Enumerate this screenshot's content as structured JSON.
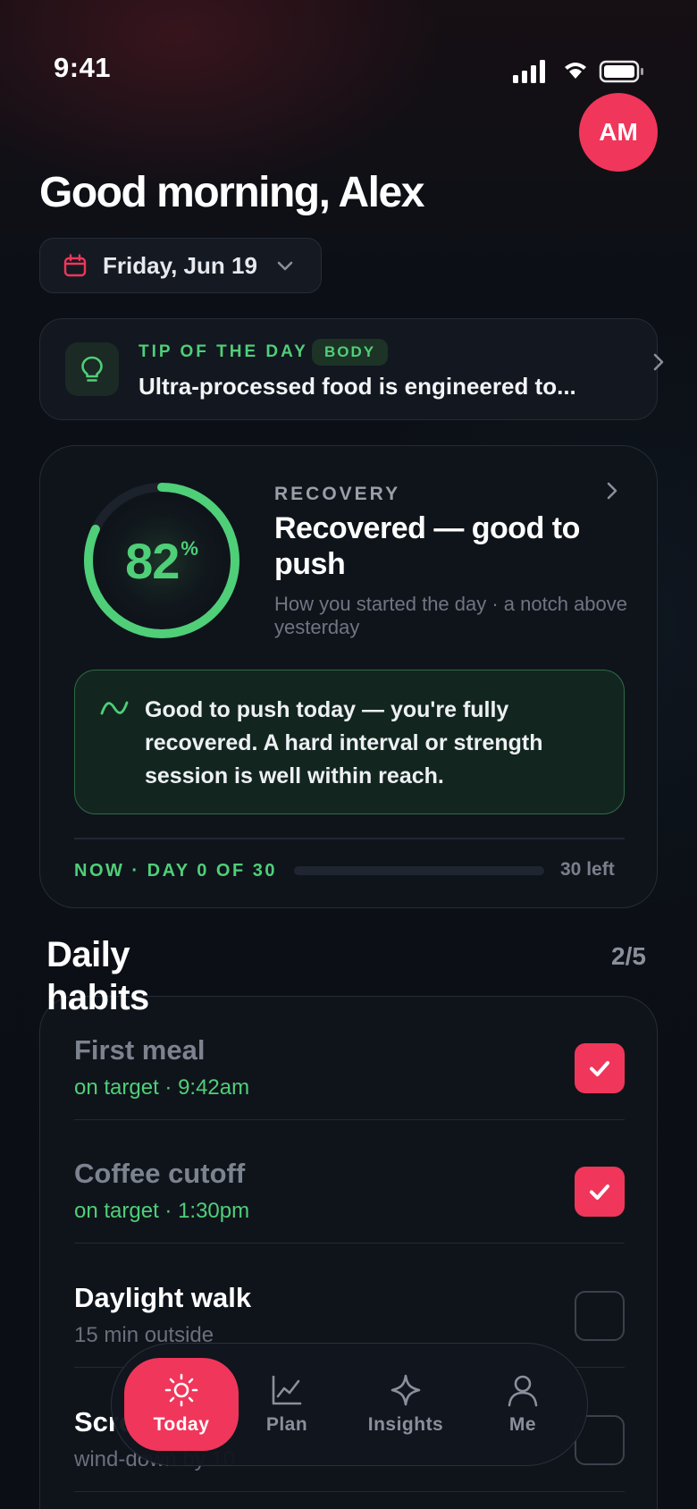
{
  "status_bar": {
    "time": "9:41"
  },
  "user": {
    "initials": "AM"
  },
  "header": {
    "greeting": "Good morning, Alex"
  },
  "date_picker": {
    "label": "Friday, Jun 19"
  },
  "tip": {
    "kicker": "TIP OF THE DAY",
    "badge": "BODY",
    "text": "Ultra-processed food is engineered to..."
  },
  "recovery": {
    "kicker": "RECOVERY",
    "score": "82",
    "score_unit": "%",
    "score_fraction": 0.82,
    "title": "Recovered — good to push",
    "subtitle": "How you started the day · a notch above yesterday",
    "note": "Good to push today — you're fully recovered. A hard interval or strength session is well within reach.",
    "progress_label": "NOW · DAY 0 OF 30",
    "progress_fraction": 0,
    "remaining": "30 left"
  },
  "habits": {
    "title": "Daily habits",
    "count": "2/5",
    "items": [
      {
        "name": "First meal",
        "meta": "on target · 9:42am",
        "done": true
      },
      {
        "name": "Coffee cutoff",
        "meta": "on target · 1:30pm",
        "done": true
      },
      {
        "name": "Daylight walk",
        "meta": "15 min outside",
        "done": false
      },
      {
        "name": "Screens off",
        "meta": "wind-down by 10",
        "done": false
      }
    ]
  },
  "nav": {
    "items": [
      {
        "label": "Today",
        "icon": "sun-icon",
        "active": true
      },
      {
        "label": "Plan",
        "icon": "chart-line-icon",
        "active": false
      },
      {
        "label": "Insights",
        "icon": "sparkle-icon",
        "active": false
      },
      {
        "label": "Me",
        "icon": "person-icon",
        "active": false
      }
    ]
  },
  "colors": {
    "accent": "#f0365a",
    "success": "#4fcf78",
    "background": "#0b0f15",
    "card": "#0f141b"
  }
}
